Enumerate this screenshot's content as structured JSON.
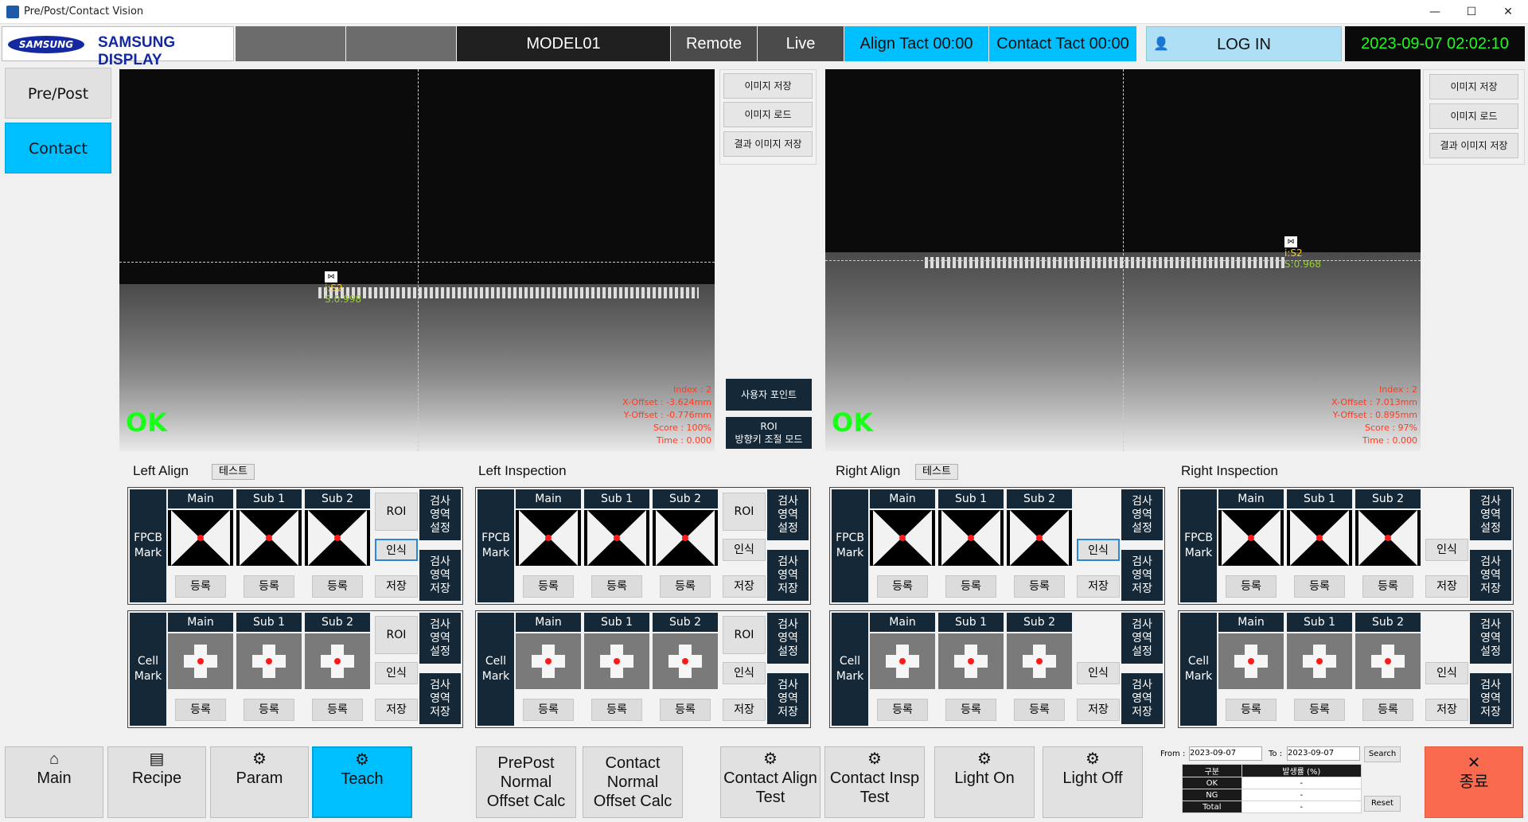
{
  "window": {
    "title": "Pre/Post/Contact Vision",
    "minimize": "—",
    "maximize": "☐",
    "close": "✕"
  },
  "header": {
    "brand_oval": "SAMSUNG",
    "brand_text": "SAMSUNG DISPLAY",
    "model": "MODEL01",
    "remote": "Remote",
    "live": "Live",
    "align_tact": "Align Tact 00:00",
    "contact_tact": "Contact Tact 00:00",
    "login": "LOG IN",
    "datetime": "2023-09-07 02:02:10"
  },
  "sidebar": {
    "items": [
      {
        "label": "Pre/Post"
      },
      {
        "label": "Contact"
      }
    ]
  },
  "cameras": [
    {
      "ok": "OK",
      "mark_label": "i:S2",
      "mark_score": "S:0.998",
      "index": "Index : 2",
      "x_offset": "X-Offset : -3.624mm",
      "y_offset": "Y-Offset : -0.776mm",
      "score": "Score : 100%",
      "time": "Time : 0.000"
    },
    {
      "ok": "OK",
      "mark_label": "i:S2",
      "mark_score": "S:0.968",
      "index": "Index : 2",
      "x_offset": "X-Offset : 7.013mm",
      "y_offset": "Y-Offset : 0.895mm",
      "score": "Score : 97%",
      "time": "Time : 0.000"
    }
  ],
  "image_buttons": {
    "save": "이미지 저장",
    "load": "이미지 로드",
    "result_save": "결과 이미지 저장",
    "user_point": "사용자 포인트",
    "roi_mode": "ROI\n방향키 조절 모드"
  },
  "sections": [
    {
      "title": "Left Align",
      "test": "테스트"
    },
    {
      "title": "Left Inspection"
    },
    {
      "title": "Right Align",
      "test": "테스트"
    },
    {
      "title": "Right Inspection"
    }
  ],
  "panel": {
    "fpcb": "FPCB\nMark",
    "cell": "Cell\nMark",
    "main": "Main",
    "sub1": "Sub 1",
    "sub2": "Sub 2",
    "register": "등록",
    "roi": "ROI",
    "recognize": "인식",
    "save": "저장",
    "area_set": "검사\n영역\n설정",
    "area_save": "검사\n영역\n저장"
  },
  "bottom": {
    "main": "Main",
    "recipe": "Recipe",
    "param": "Param",
    "teach": "Teach",
    "prepost_calc": "PrePost\nNormal\nOffset Calc",
    "contact_calc": "Contact\nNormal\nOffset Calc",
    "contact_align_test": "Contact Align\nTest",
    "contact_insp_test": "Contact Insp\nTest",
    "light_on": "Light On",
    "light_off": "Light Off",
    "exit": "종료"
  },
  "stats": {
    "from_label": "From :",
    "from": "2023-09-07",
    "to_label": "To :",
    "to": "2023-09-07",
    "search": "Search",
    "reset": "Reset",
    "col1": "구분",
    "col2": "발생률 (%)",
    "rows": [
      {
        "name": "OK",
        "val": "-"
      },
      {
        "name": "NG",
        "val": "-"
      },
      {
        "name": "Total",
        "val": "-"
      }
    ]
  },
  "colors": {
    "accent": "#00bfff",
    "dark": "#152838",
    "ok": "#1aff1a",
    "exit": "#f96a4e"
  }
}
